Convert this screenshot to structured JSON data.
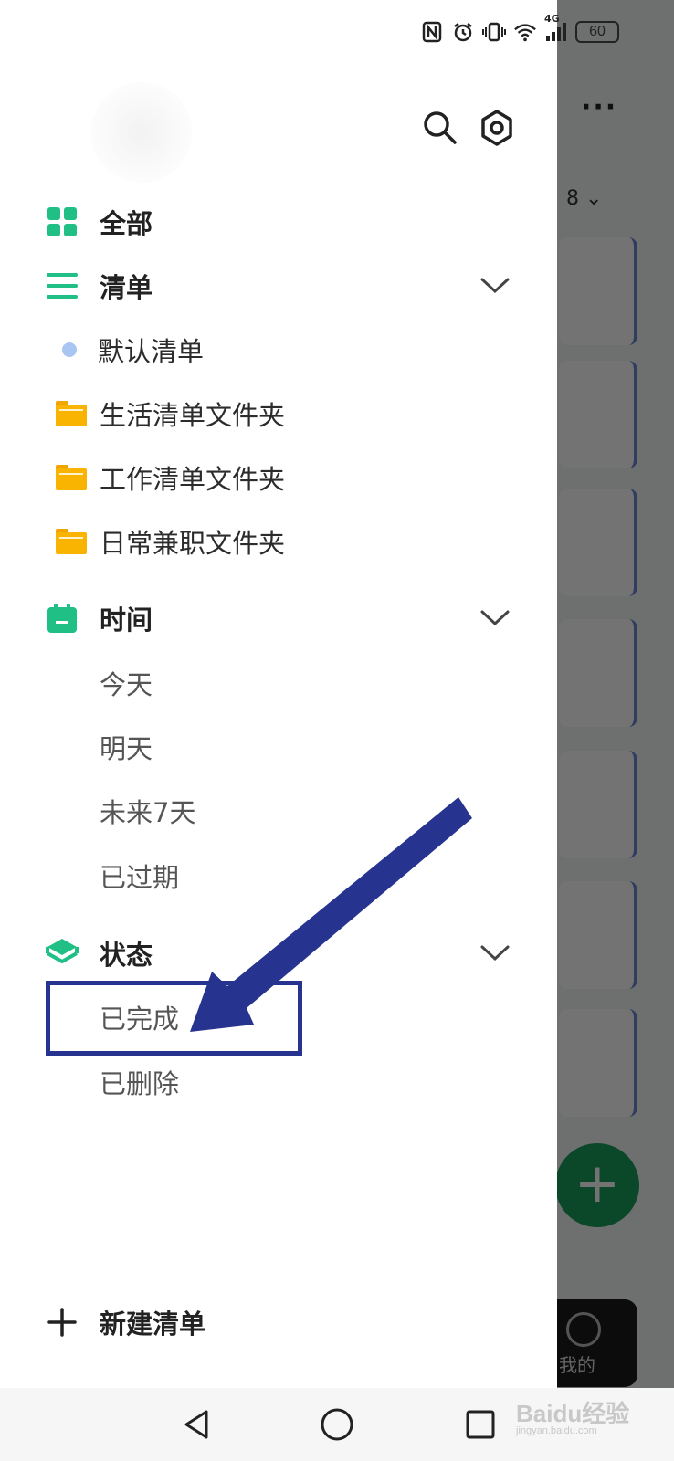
{
  "status_bar": {
    "battery": "60",
    "network": "4G"
  },
  "background": {
    "count": "8",
    "tab_label": "我的"
  },
  "drawer": {
    "all": "全部",
    "lists_header": "清单",
    "lists": [
      {
        "label": "默认清单",
        "type": "dot"
      },
      {
        "label": "生活清单文件夹",
        "type": "folder"
      },
      {
        "label": "工作清单文件夹",
        "type": "folder"
      },
      {
        "label": "日常兼职文件夹",
        "type": "folder"
      }
    ],
    "time_header": "时间",
    "time_items": [
      "今天",
      "明天",
      "未来7天",
      "已过期"
    ],
    "status_header": "状态",
    "status_items": [
      "已完成",
      "已删除"
    ],
    "new_list": "新建清单"
  },
  "colors": {
    "accent": "#1fbf86",
    "folder": "#f8b400",
    "annotation": "#26338f"
  },
  "watermark": {
    "text": "Baidu经验",
    "sub": "jingyan.baidu.com"
  }
}
